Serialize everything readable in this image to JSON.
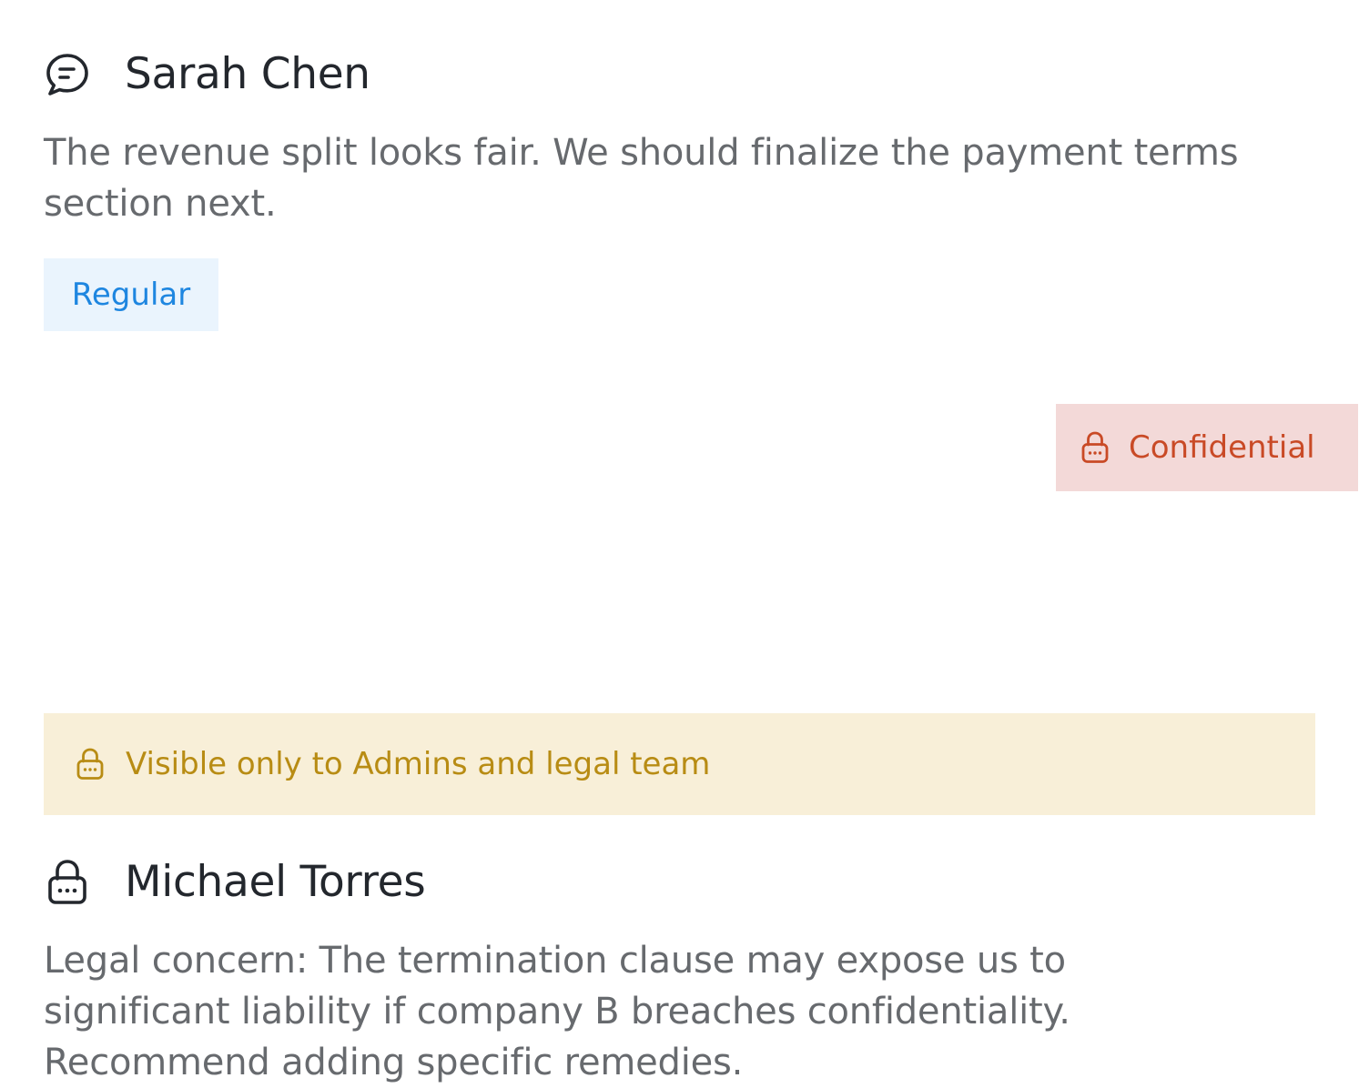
{
  "comments": [
    {
      "author": "Sarah Chen",
      "author_icon": "chat-bubble-icon",
      "body": "The revenue split looks fair. We should finalize the payment terms section next.",
      "tag": "Regular"
    },
    {
      "author": "Michael Torres",
      "author_icon": "lock-icon",
      "body": "Legal concern: The termination clause may expose us to significant liability if company B breaches confidentiality. Recommend adding specific remedies.",
      "badge": "Confidential",
      "badge_icon": "lock-icon",
      "visibility_notice": "Visible only to Admins and legal team",
      "visibility_icon": "lock-icon"
    }
  ],
  "colors": {
    "regular_tag_bg": "#eaf4fd",
    "regular_tag_text": "#1e86e0",
    "confidential_bg": "#f3d9d8",
    "confidential_text": "#c94a26",
    "notice_bg": "#f8efd8",
    "notice_text": "#b88c14"
  }
}
